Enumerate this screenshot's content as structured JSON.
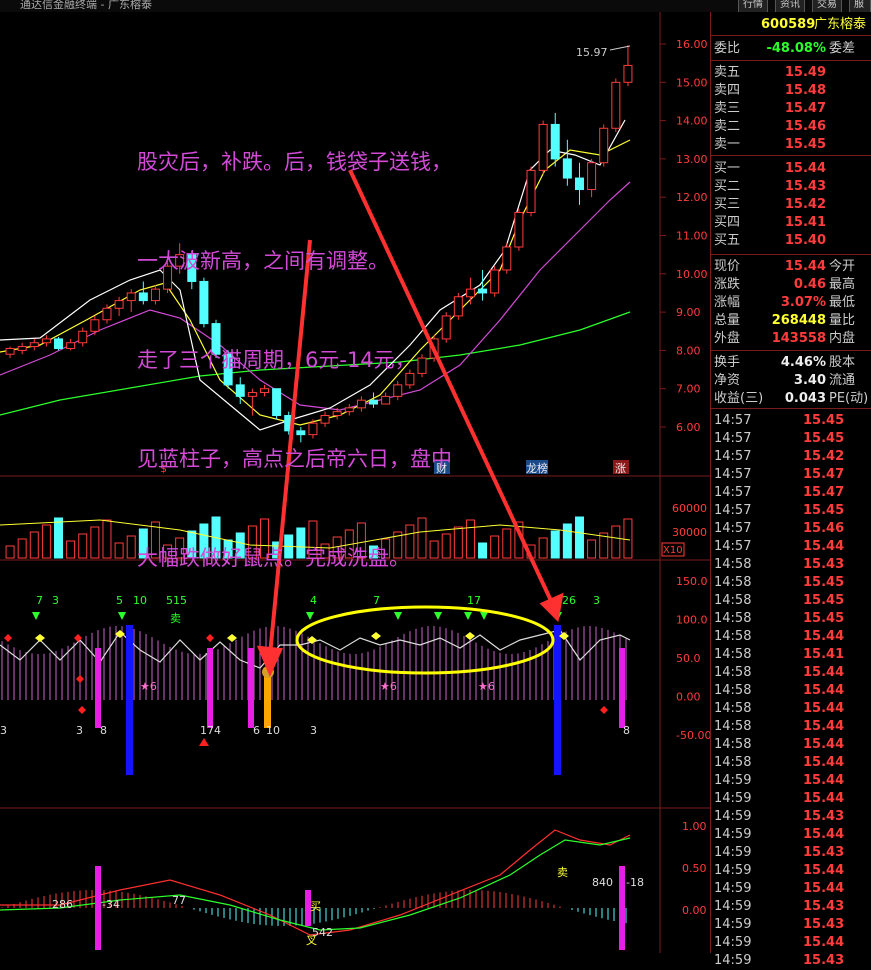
{
  "window": {
    "title": "通达信金融终端 - 广东榕泰"
  },
  "toolbar": {
    "tabs": [
      "行情",
      "资讯",
      "交易",
      "服务"
    ]
  },
  "stock": {
    "code": "600589",
    "name": "广东榕泰"
  },
  "annotation": {
    "lines": [
      "股灾后，补跌。后，钱袋子送钱，",
      "一大波新高，之间有调整。",
      "走了三个猫周期，6元-14元，",
      "见蓝柱子，高点之后帝六日，盘中",
      "大幅跌做好鼠点。完成洗盘。"
    ]
  },
  "price_axis": [
    "16.00",
    "15.00",
    "14.00",
    "13.00",
    "12.00",
    "11.00",
    "10.00",
    "9.00",
    "8.00",
    "7.00",
    "6.00"
  ],
  "volume_axis": [
    "60000",
    "30000"
  ],
  "volume_multiplier": "X10",
  "indicator_axis": [
    "150.0",
    "100.0",
    "50.0",
    "0.00",
    "-50.00"
  ],
  "macd_axis": [
    "1.00",
    "0.50",
    "0.00"
  ],
  "peak_label": "15.97",
  "event_badges": [
    "$",
    "财",
    "龙榜",
    "涨"
  ],
  "markers": {
    "top_numbers": [
      "7",
      "3",
      "5",
      "10",
      "515",
      "4",
      "7",
      "17",
      "26",
      "3"
    ],
    "sell": "卖",
    "bottom_numbers": [
      "3",
      "3",
      "8",
      "174",
      "6",
      "10",
      "3",
      "8"
    ],
    "macd_values": [
      "286",
      "-34",
      "77",
      "542",
      "840",
      "-18"
    ],
    "macd_buy": "买",
    "macd_cross": "叉",
    "macd_sell": "卖",
    "star": "★6"
  },
  "quote": {
    "weibi": {
      "label": "委比",
      "value": "-48.08%",
      "label2": "委差"
    },
    "asks": [
      {
        "label": "卖五",
        "price": "15.49"
      },
      {
        "label": "卖四",
        "price": "15.48"
      },
      {
        "label": "卖三",
        "price": "15.47"
      },
      {
        "label": "卖二",
        "price": "15.46"
      },
      {
        "label": "卖一",
        "price": "15.45"
      }
    ],
    "bids": [
      {
        "label": "买一",
        "price": "15.44"
      },
      {
        "label": "买二",
        "price": "15.43"
      },
      {
        "label": "买三",
        "price": "15.42"
      },
      {
        "label": "买四",
        "price": "15.41"
      },
      {
        "label": "买五",
        "price": "15.40"
      }
    ],
    "stats": [
      {
        "label": "现价",
        "value": "15.44",
        "label2": "今开",
        "color": "red"
      },
      {
        "label": "涨跌",
        "value": "0.46",
        "label2": "最高",
        "color": "red"
      },
      {
        "label": "涨幅",
        "value": "3.07%",
        "label2": "最低",
        "color": "red"
      },
      {
        "label": "总量",
        "value": "268448",
        "label2": "量比",
        "color": "yellow"
      },
      {
        "label": "外盘",
        "value": "143558",
        "label2": "内盘",
        "color": "red"
      }
    ],
    "stats2": [
      {
        "label": "换手",
        "value": "4.46%",
        "label2": "股本"
      },
      {
        "label": "净资",
        "value": "3.40",
        "label2": "流通"
      },
      {
        "label": "收益(三)",
        "value": "0.043",
        "label2": "PE(动)"
      }
    ],
    "ticks": [
      {
        "time": "14:57",
        "price": "15.45",
        "c": "red"
      },
      {
        "time": "14:57",
        "price": "15.45",
        "c": "red"
      },
      {
        "time": "14:57",
        "price": "15.42",
        "c": "red"
      },
      {
        "time": "14:57",
        "price": "15.47",
        "c": "red"
      },
      {
        "time": "14:57",
        "price": "15.47",
        "c": "red"
      },
      {
        "time": "14:57",
        "price": "15.45",
        "c": "red"
      },
      {
        "time": "14:57",
        "price": "15.46",
        "c": "red"
      },
      {
        "time": "14:57",
        "price": "15.44",
        "c": "red"
      },
      {
        "time": "14:58",
        "price": "15.43",
        "c": "red"
      },
      {
        "time": "14:58",
        "price": "15.45",
        "c": "red"
      },
      {
        "time": "14:58",
        "price": "15.45",
        "c": "red"
      },
      {
        "time": "14:58",
        "price": "15.45",
        "c": "red"
      },
      {
        "time": "14:58",
        "price": "15.44",
        "c": "red"
      },
      {
        "time": "14:58",
        "price": "15.41",
        "c": "red"
      },
      {
        "time": "14:58",
        "price": "15.44",
        "c": "red"
      },
      {
        "time": "14:58",
        "price": "15.44",
        "c": "red"
      },
      {
        "time": "14:58",
        "price": "15.44",
        "c": "red"
      },
      {
        "time": "14:58",
        "price": "15.44",
        "c": "red"
      },
      {
        "time": "14:58",
        "price": "15.44",
        "c": "red"
      },
      {
        "time": "14:58",
        "price": "15.44",
        "c": "red"
      },
      {
        "time": "14:59",
        "price": "15.44",
        "c": "red"
      },
      {
        "time": "14:59",
        "price": "15.44",
        "c": "red"
      },
      {
        "time": "14:59",
        "price": "15.43",
        "c": "red"
      },
      {
        "time": "14:59",
        "price": "15.44",
        "c": "red"
      },
      {
        "time": "14:59",
        "price": "15.43",
        "c": "red"
      },
      {
        "time": "14:59",
        "price": "15.44",
        "c": "red"
      },
      {
        "time": "14:59",
        "price": "15.44",
        "c": "red"
      },
      {
        "time": "14:59",
        "price": "15.43",
        "c": "red"
      },
      {
        "time": "14:59",
        "price": "15.43",
        "c": "red"
      },
      {
        "time": "14:59",
        "price": "15.44",
        "c": "red"
      },
      {
        "time": "14:59",
        "price": "15.43",
        "c": "red"
      }
    ]
  },
  "colors": {
    "up": "#ff3c3c",
    "down": "#54ffff",
    "ma5": "#ffffff",
    "ma10": "#ffff33",
    "ma20": "#d24ad6",
    "ma60": "#2cff2c",
    "annotation": "#d24ad6",
    "arrow": "#ff3030",
    "ellipse": "#ffff00"
  },
  "chart_data": {
    "type": "candlestick",
    "series": [
      {
        "values": [
          [
            7.9,
            8.1,
            7.8,
            8.05
          ],
          [
            8.0,
            8.2,
            7.9,
            8.1
          ],
          [
            8.1,
            8.3,
            8.0,
            8.2
          ],
          [
            8.2,
            8.4,
            8.1,
            8.3
          ],
          [
            8.3,
            8.35,
            8.0,
            8.05
          ],
          [
            8.05,
            8.3,
            8.0,
            8.2
          ],
          [
            8.2,
            8.6,
            8.1,
            8.5
          ],
          [
            8.5,
            8.9,
            8.4,
            8.8
          ],
          [
            8.8,
            9.2,
            8.7,
            9.1
          ],
          [
            9.1,
            9.4,
            8.9,
            9.3
          ],
          [
            9.3,
            9.6,
            9.0,
            9.5
          ],
          [
            9.5,
            9.8,
            9.2,
            9.3
          ],
          [
            9.3,
            9.7,
            9.2,
            9.6
          ],
          [
            9.6,
            10.3,
            9.5,
            10.2
          ],
          [
            10.2,
            10.8,
            10.0,
            10.5
          ],
          [
            10.5,
            10.6,
            9.6,
            9.8
          ],
          [
            9.8,
            9.9,
            8.6,
            8.7
          ],
          [
            8.7,
            8.8,
            7.8,
            7.9
          ],
          [
            7.9,
            8.0,
            7.0,
            7.1
          ],
          [
            7.1,
            7.3,
            6.6,
            6.8
          ],
          [
            6.8,
            7.0,
            6.3,
            6.9
          ],
          [
            6.9,
            7.1,
            6.8,
            7.0
          ],
          [
            7.0,
            7.0,
            6.2,
            6.3
          ],
          [
            6.3,
            6.4,
            5.8,
            5.9
          ],
          [
            5.9,
            6.0,
            5.6,
            5.8
          ],
          [
            5.8,
            6.2,
            5.7,
            6.1
          ],
          [
            6.1,
            6.4,
            6.0,
            6.3
          ],
          [
            6.3,
            6.5,
            6.2,
            6.4
          ],
          [
            6.4,
            6.6,
            6.3,
            6.5
          ],
          [
            6.5,
            6.8,
            6.4,
            6.7
          ],
          [
            6.7,
            6.9,
            6.5,
            6.6
          ],
          [
            6.6,
            6.9,
            6.6,
            6.8
          ],
          [
            6.8,
            7.2,
            6.7,
            7.1
          ],
          [
            7.1,
            7.5,
            7.0,
            7.4
          ],
          [
            7.4,
            7.9,
            7.3,
            7.8
          ],
          [
            7.8,
            8.4,
            7.7,
            8.3
          ],
          [
            8.3,
            9.0,
            8.2,
            8.9
          ],
          [
            8.9,
            9.5,
            8.8,
            9.4
          ],
          [
            9.4,
            9.9,
            9.2,
            9.6
          ],
          [
            9.6,
            10.1,
            9.3,
            9.5
          ],
          [
            9.5,
            10.2,
            9.4,
            10.1
          ],
          [
            10.1,
            10.8,
            10.0,
            10.7
          ],
          [
            10.7,
            11.7,
            10.6,
            11.6
          ],
          [
            11.6,
            12.8,
            11.5,
            12.7
          ],
          [
            12.7,
            14.0,
            12.6,
            13.9
          ],
          [
            13.9,
            14.2,
            12.8,
            13.0
          ],
          [
            13.0,
            13.5,
            12.3,
            12.5
          ],
          [
            12.5,
            12.9,
            11.8,
            12.2
          ],
          [
            12.2,
            13.0,
            12.0,
            12.9
          ],
          [
            12.9,
            13.9,
            12.8,
            13.8
          ],
          [
            13.8,
            15.1,
            13.7,
            15.0
          ],
          [
            15.0,
            15.97,
            14.9,
            15.44
          ]
        ]
      }
    ],
    "ylim": [
      5.5,
      16.3
    ]
  }
}
